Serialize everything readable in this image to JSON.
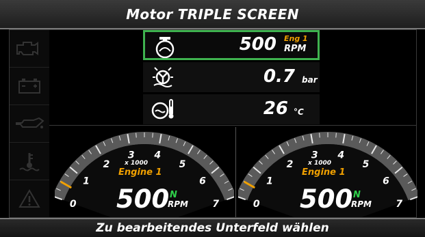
{
  "title": "Motor TRIPLE SCREEN",
  "sidebar": {
    "items": [
      {
        "icon": "check-engine-icon"
      },
      {
        "icon": "battery-icon"
      },
      {
        "icon": "oil-pressure-icon"
      },
      {
        "icon": "coolant-temperature-icon"
      },
      {
        "icon": "warning-icon"
      }
    ]
  },
  "fields": {
    "rpm": {
      "icon": "engine-icon",
      "value": "500",
      "tag": "Eng 1",
      "unit": "RPM"
    },
    "boost": {
      "icon": "turbo-icon",
      "value": "0.7",
      "unit": "bar"
    },
    "temp": {
      "icon": "coolant-temp-icon",
      "value": "26",
      "unit": "°C"
    }
  },
  "gauges": [
    {
      "engine_label": "Engine 1",
      "multiplier": "x 1000",
      "value": "500",
      "gear": "N",
      "unit": "RPM",
      "ticks": [
        "0",
        "1",
        "2",
        "3",
        "4",
        "5",
        "6",
        "7"
      ],
      "needle_fraction": 0.07
    },
    {
      "engine_label": "Engine 1",
      "multiplier": "x 1000",
      "value": "500",
      "gear": "N",
      "unit": "RPM",
      "ticks": [
        "0",
        "1",
        "2",
        "3",
        "4",
        "5",
        "6",
        "7"
      ],
      "needle_fraction": 0.07
    }
  ],
  "colors": {
    "selection": "#3fb34f",
    "accent": "#f0a000",
    "gear": "#2fcf4a"
  },
  "status": "Zu bearbeitendes Unterfeld wählen"
}
